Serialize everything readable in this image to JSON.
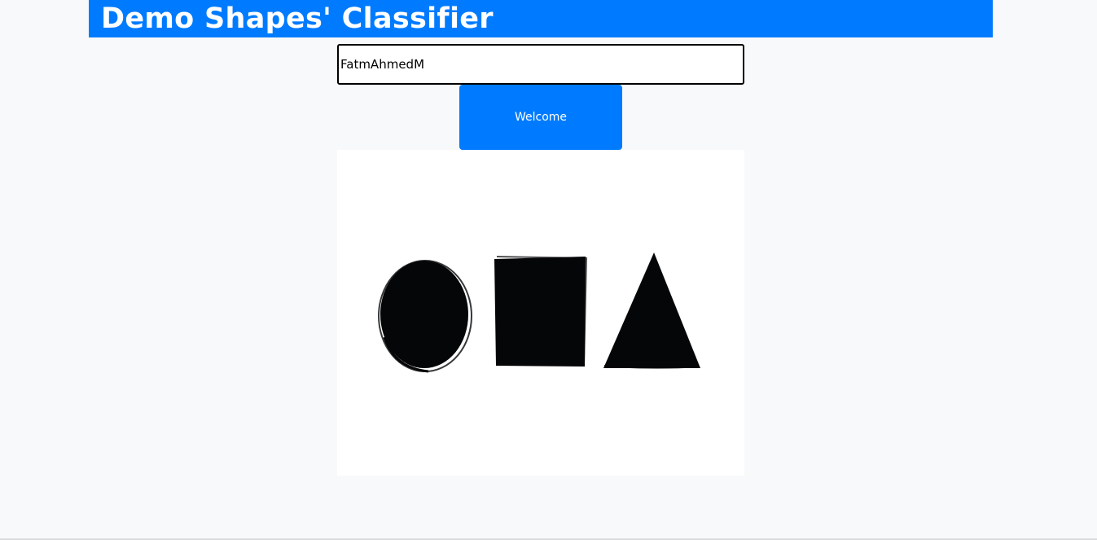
{
  "header": {
    "title": "Demo Shapes' Classifier"
  },
  "form": {
    "name_value": "FatmAhmedM",
    "button_label": "Welcome"
  },
  "image": {
    "shapes": [
      "circle-shape",
      "square-shape",
      "triangle-shape"
    ]
  },
  "colors": {
    "accent": "#007bff",
    "background": "#f8f9fa",
    "shape_fill": "#050608"
  }
}
